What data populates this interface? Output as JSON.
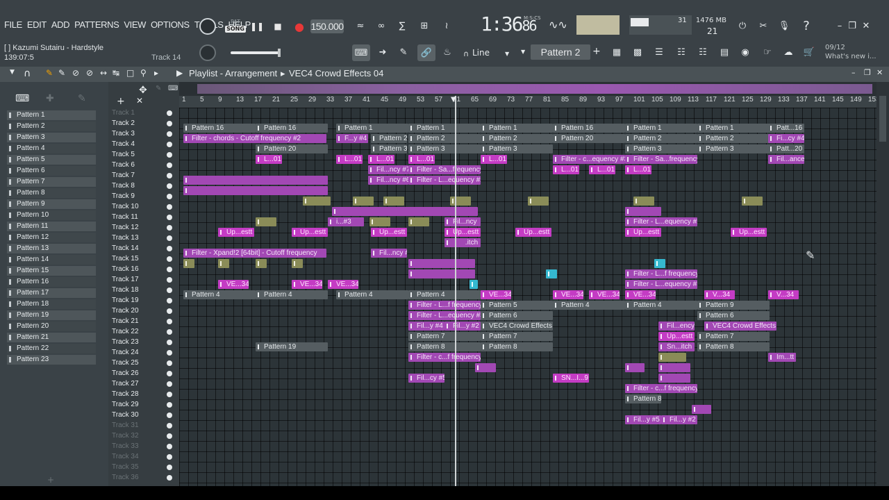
{
  "menu": [
    "FILE",
    "EDIT",
    "ADD",
    "PATTERNS",
    "VIEW",
    "OPTIONS",
    "TOOLS",
    "HELP"
  ],
  "hint": {
    "line1": "[ ] Kazumi Sutairu - Hardstyle",
    "line2": "139:07:5",
    "track": "Track 14"
  },
  "transport": {
    "pat": "PAT",
    "song": "SONG",
    "tempo": "150.000",
    "time": "1:36",
    "time_sub": "86",
    "time_label": "M:S:CS"
  },
  "cpu": {
    "voices": "31",
    "memory": "1476 MB",
    "poly": "21"
  },
  "snap": {
    "mode": "Line",
    "pattern": "Pattern 2"
  },
  "news": {
    "date": "09/12",
    "text": "What's new i..."
  },
  "playlist": {
    "title": "Playlist - Arrangement",
    "crumb": "VEC4 Crowd Effects 04"
  },
  "patterns": [
    "Pattern 1",
    "Pattern 2",
    "Pattern 3",
    "Pattern 4",
    "Pattern 5",
    "Pattern 6",
    "Pattern 7",
    "Pattern 8",
    "Pattern 9",
    "Pattern 10",
    "Pattern 11",
    "Pattern 12",
    "Pattern 13",
    "Pattern 14",
    "Pattern 15",
    "Pattern 16",
    "Pattern 17",
    "Pattern 18",
    "Pattern 19",
    "Pattern 20",
    "Pattern 21",
    "Pattern 22",
    "Pattern 23"
  ],
  "tracks": [
    "Track 1",
    "Track 2",
    "Track 3",
    "Track 4",
    "Track 5",
    "Track 6",
    "Track 7",
    "Track 8",
    "Track 9",
    "Track 10",
    "Track 11",
    "Track 12",
    "Track 13",
    "Track 14",
    "Track 15",
    "Track 16",
    "Track 17",
    "Track 18",
    "Track 19",
    "Track 20",
    "Track 21",
    "Track 22",
    "Track 23",
    "Track 24",
    "Track 25",
    "Track 26",
    "Track 27",
    "Track 28",
    "Track 29",
    "Track 30",
    "Track 31",
    "Track 32",
    "Track 33",
    "Track 34",
    "Track 35",
    "Track 36"
  ],
  "ruler": [
    "1",
    "5",
    "9",
    "13",
    "17",
    "21",
    "25",
    "29",
    "33",
    "37",
    "41",
    "45",
    "49",
    "53",
    "57",
    "61",
    "65",
    "69",
    "73",
    "77",
    "81",
    "85",
    "89",
    "93",
    "97",
    "101",
    "105",
    "109",
    "113",
    "117",
    "121",
    "125",
    "129",
    "133",
    "137",
    "141",
    "145",
    "149",
    "153"
  ],
  "clips": {
    "t2": [
      "Pattern 16",
      "Pattern 16",
      "Pattern 1",
      "Pattern 1",
      "Pattern 1",
      "Pattern 16",
      "Pattern 1",
      "Pattern 1",
      "Patt...16"
    ],
    "t3a": "Filter - chords - Cutoff frequency #2",
    "t3": [
      "F...y #4",
      "Pattern 2",
      "Pattern 2",
      "Pattern 2",
      "Pattern 20",
      "Pattern 2",
      "Pattern 2",
      "Fi...cy #4"
    ],
    "t4": [
      "Pattern 20",
      "Pattern 3",
      "Pattern 3",
      "Pattern 3",
      "Pattern 3",
      "Pattern 3",
      "Patt...20"
    ],
    "t5": [
      "L...01",
      "L...01",
      "L...01",
      "L...01",
      "L...01",
      "Filter - c...equency #3",
      "Filter - Sa...frequency",
      "Fil...ance"
    ],
    "t6": [
      "Fil...ncy #7",
      "Filter - Sa...frequency",
      "L...01",
      "L...01",
      "L...01"
    ],
    "t7": [
      "Fil...ncy #6",
      "Filter - L...equency #2"
    ],
    "t11": [
      "i...#3",
      "Fil...ncy",
      "Filter - L...equency #2"
    ],
    "t12": [
      "Up...estt",
      "Up...estt",
      "Up...estt",
      "Up...estt",
      "Up...estt",
      "Up...estt",
      "Up...estt"
    ],
    "t13": "Sn...itch",
    "t14a": "Filter - Xpand!2 [64bit] - Cutoff frequency",
    "t14": "Fil...ncy #2",
    "t16": "Filter - L...f frequency",
    "t17": [
      "VE...34",
      "VE...34",
      "VE...34",
      "Filter - L...equency #3"
    ],
    "t18": [
      "Pattern 4",
      "Pattern 4",
      "Pattern 4",
      "Pattern 4",
      "VE...34",
      "VE...34",
      "VE...34",
      "VE...34",
      "V...34",
      "V...34"
    ],
    "t19": [
      "Filter - L...f frequency",
      "Pattern 5",
      "Pattern 4",
      "Pattern 4",
      "Pattern 9"
    ],
    "t20": [
      "Filter - L...equency #3",
      "Pattern 6",
      "Pattern 6"
    ],
    "t21": [
      "Fil...y #4",
      "Fil...y #2",
      "VEC4 Crowd Effects 04",
      "Fil...ency",
      "VEC4 Crowd Effects 04"
    ],
    "t22": [
      "Pattern 7",
      "Pattern 7",
      "Up...estt",
      "Pattern 7"
    ],
    "t23": [
      "Pattern 19",
      "Pattern 8",
      "Pattern 8",
      "Sn...itch",
      "Pattern 8"
    ],
    "t24": [
      "Filter - c...f frequency",
      "Im...tt"
    ],
    "t26": [
      "Fil...cy #5",
      "SN...I...9"
    ],
    "t27": "Filter - c...f frequency",
    "t28": "Pattern 8",
    "t30": [
      "Fil...y #5",
      "Fil...y #2"
    ]
  }
}
